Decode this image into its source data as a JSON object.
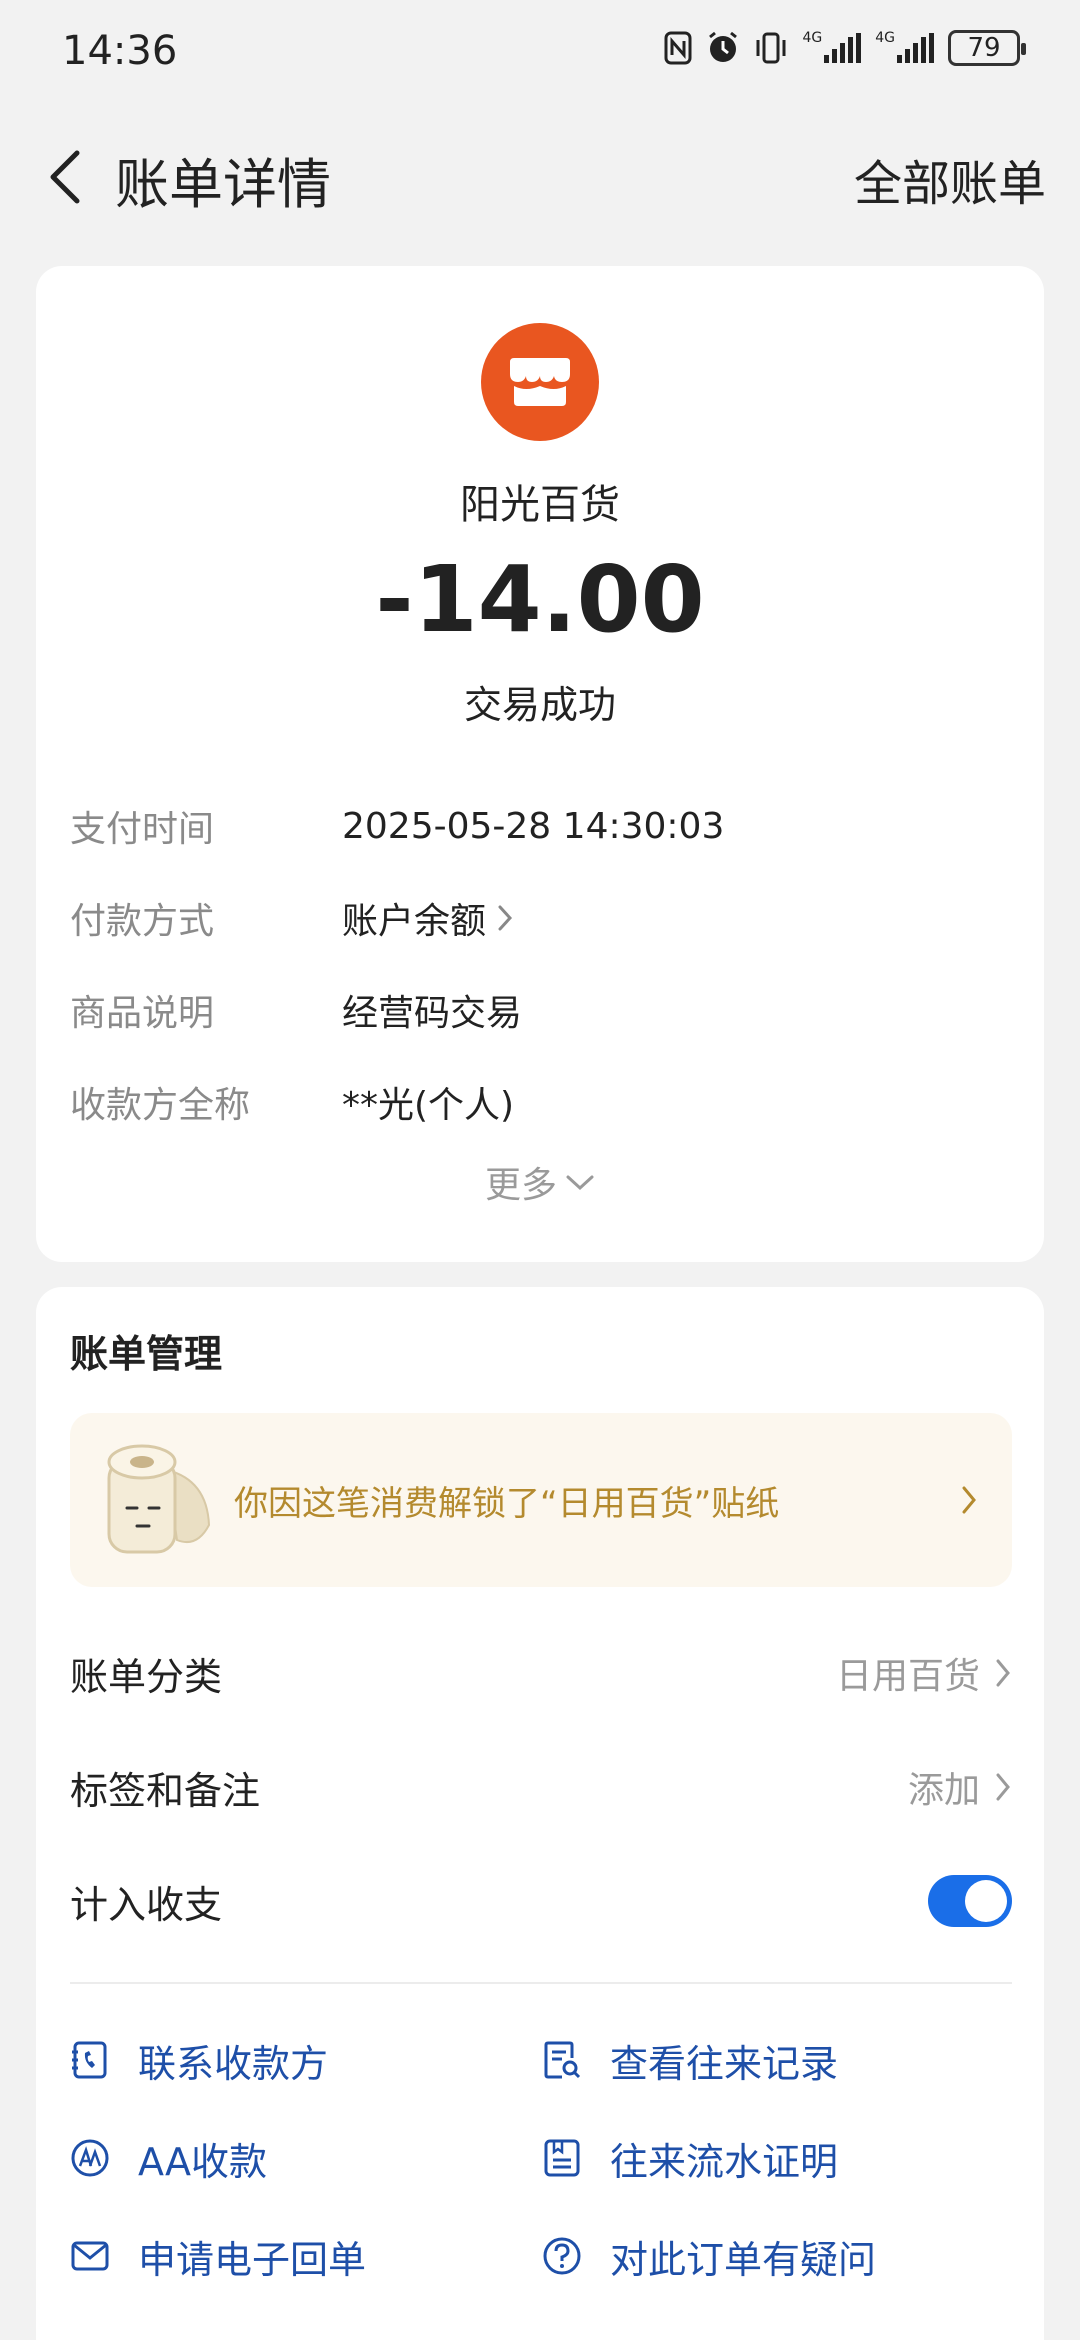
{
  "status_bar": {
    "time": "14:36",
    "net1": "4G",
    "net2": "4G",
    "battery": "79"
  },
  "header": {
    "title": "账单详情",
    "right_link": "全部账单"
  },
  "transaction": {
    "merchant": "阳光百货",
    "amount": "-14.00",
    "status": "交易成功",
    "logo_color": "#e95620"
  },
  "details": [
    {
      "label": "支付时间",
      "value": "2025-05-28 14:30:03"
    },
    {
      "label": "付款方式",
      "value": "账户余额"
    },
    {
      "label": "商品说明",
      "value": "经营码交易"
    },
    {
      "label": "收款方全称",
      "value": "**光(个人)"
    }
  ],
  "more_label": "更多",
  "management": {
    "title": "账单管理",
    "sticker_text": "你因这笔消费解锁了“日用百货”贴纸",
    "category_label": "账单分类",
    "category_value": "日用百货",
    "tags_label": "标签和备注",
    "tags_value": "添加",
    "include_label": "计入收支",
    "include_enabled": true
  },
  "actions": [
    {
      "label": "联系收款方",
      "icon": "phone-contact-icon"
    },
    {
      "label": "查看往来记录",
      "icon": "records-search-icon"
    },
    {
      "label": "AA收款",
      "icon": "aa-icon"
    },
    {
      "label": "往来流水证明",
      "icon": "statement-icon"
    },
    {
      "label": "申请电子回单",
      "icon": "mail-icon"
    },
    {
      "label": "对此订单有疑问",
      "icon": "question-icon"
    }
  ],
  "colors": {
    "accent": "#1a6ee8",
    "link": "#1e4fa8",
    "sticker_text": "#b48a2e",
    "sticker_bg": "#fcf7ee"
  }
}
